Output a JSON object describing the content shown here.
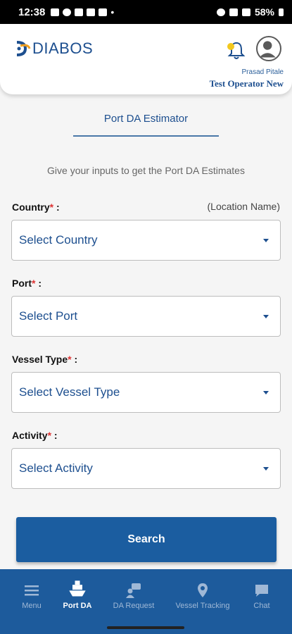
{
  "status_bar": {
    "time": "12:38",
    "battery": "58%"
  },
  "header": {
    "logo_text": "DIABOS",
    "user_name": "Prasad Pitale",
    "user_role": "Test Operator New"
  },
  "page": {
    "title": "Port DA Estimator",
    "subtitle": "Give your inputs to get the Port DA Estimates"
  },
  "form": {
    "country": {
      "label": "Country",
      "required_mark": "*",
      "colon": " :",
      "hint": "(Location Name)",
      "value": "Select Country"
    },
    "port": {
      "label": "Port",
      "required_mark": "*",
      "colon": " :",
      "value": "Select Port"
    },
    "vessel_type": {
      "label": "Vessel Type",
      "required_mark": "*",
      "colon": " :",
      "value": "Select Vessel Type"
    },
    "activity": {
      "label": "Activity",
      "required_mark": "*",
      "colon": " :",
      "value": "Select Activity"
    },
    "search_label": "Search"
  },
  "nav": {
    "items": [
      {
        "label": "Menu",
        "icon": "menu-icon"
      },
      {
        "label": "Port DA",
        "icon": "ship-icon",
        "active": true
      },
      {
        "label": "DA Request",
        "icon": "chat-user-icon"
      },
      {
        "label": "Vessel Tracking",
        "icon": "location-pin-icon"
      },
      {
        "label": "Chat",
        "icon": "chat-icon"
      }
    ]
  },
  "colors": {
    "brand": "#1d4f8f",
    "nav_bg": "#1d5b9c",
    "button": "#1b5da0",
    "required": "#d33333"
  }
}
